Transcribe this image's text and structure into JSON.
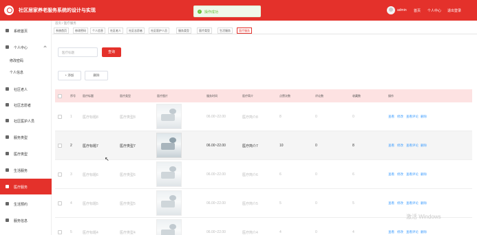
{
  "header": {
    "title": "社区居家养老服务系统的设计与实现",
    "toast": "操作成功",
    "username": "admin",
    "links": [
      "首页",
      "个人中心",
      "退出登录"
    ],
    "brand_color": "#e4312b"
  },
  "sidebar": {
    "items": [
      {
        "label": "系统首页",
        "icon": "home-icon"
      },
      {
        "label": "个人中心",
        "icon": "user-icon"
      },
      {
        "label": "社区老人",
        "icon": "grid-icon"
      },
      {
        "label": "社区志愿者",
        "icon": "grid-icon"
      },
      {
        "label": "社区医护人员",
        "icon": "grid-icon"
      },
      {
        "label": "服务类型",
        "icon": "grid-icon"
      },
      {
        "label": "医疗类型",
        "icon": "grid-icon"
      },
      {
        "label": "生活服务",
        "icon": "grid-icon"
      },
      {
        "label": "医疗服务",
        "icon": "grid-icon"
      },
      {
        "label": "生活预约",
        "icon": "grid-icon"
      },
      {
        "label": "服务信息",
        "icon": "grid-icon"
      }
    ],
    "subitems": [
      "修改密码",
      "个人信息"
    ]
  },
  "breadcrumb": "首页 / 医疗服务",
  "tabs": [
    "系统首页",
    "修改密码",
    "个人信息",
    "社区老人",
    "社区志愿者",
    "社区医护人员",
    "服务类型",
    "医疗类型",
    "生活服务",
    "医疗服务"
  ],
  "search": {
    "placeholder": "医疗标题",
    "button": "查询"
  },
  "toolbar": {
    "add": "+ 添加",
    "delete": "删除"
  },
  "table": {
    "headers": [
      "序号",
      "医疗标题",
      "医疗类型",
      "医疗图片",
      "服务时间",
      "医疗简介",
      "点赞次数",
      "评论数",
      "收藏数",
      "操作"
    ],
    "rows": [
      {
        "idx": "1",
        "title": "医疗标题8",
        "type": "医疗类型8",
        "time": "06.00~22.00",
        "intro": "医疗简介8",
        "likes": "8",
        "comments": "0",
        "favs": "0"
      },
      {
        "idx": "2",
        "title": "医疗标题7",
        "type": "医疗类型7",
        "time": "06.00~22.00",
        "intro": "医疗简介7",
        "likes": "10",
        "comments": "0",
        "favs": "8"
      },
      {
        "idx": "3",
        "title": "医疗标题6",
        "type": "医疗类型6",
        "time": "06.00~22.00",
        "intro": "医疗简介6",
        "likes": "6",
        "comments": "0",
        "favs": "6"
      },
      {
        "idx": "4",
        "title": "医疗标题5",
        "type": "医疗类型5",
        "time": "06.00~22.00",
        "intro": "医疗简介5",
        "likes": "5",
        "comments": "0",
        "favs": "5"
      },
      {
        "idx": "5",
        "title": "医疗标题4",
        "type": "医疗类型4",
        "time": "06.00~22.00",
        "intro": "医疗简介4",
        "likes": "4",
        "comments": "0",
        "favs": "4"
      }
    ],
    "actions": [
      "查看",
      "修改",
      "查看评论",
      "删除"
    ]
  },
  "watermark": "激活 Windows"
}
